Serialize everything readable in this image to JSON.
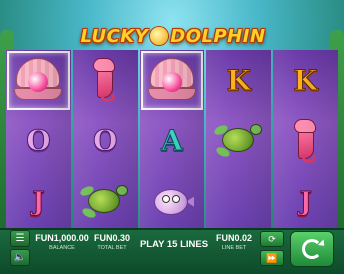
{
  "game": {
    "logo_text_left": "LUCKY",
    "logo_text_right": "DOLPHIN"
  },
  "reels": [
    [
      "pearl-shell",
      "O",
      "J"
    ],
    [
      "seahorse",
      "O",
      "turtle"
    ],
    [
      "pearl-shell",
      "A",
      "puffer-fish"
    ],
    [
      "K",
      "turtle",
      ""
    ],
    [
      "K",
      "seahorse",
      "J"
    ]
  ],
  "win_cells": [
    [
      0,
      0
    ],
    [
      2,
      0
    ]
  ],
  "hud": {
    "menu_icon": "menu-icon",
    "sound_icon": "sound-icon",
    "balance_value": "FUN1,000.00",
    "balance_label": "BALANCE",
    "total_bet_value": "FUN0.30",
    "total_bet_label": "TOTAL BET",
    "play_label": "PLAY 15 LINES",
    "line_bet_value": "FUN0.02",
    "line_bet_label": "LINE BET",
    "autoplay_icon": "autoplay-icon",
    "fast_icon": "fast-forward-icon",
    "spin_icon": "spin-icon"
  },
  "colors": {
    "reel_purple": "#8e58c4",
    "bar_green": "#1a6a3e",
    "logo_gold": "#ffd02a"
  }
}
